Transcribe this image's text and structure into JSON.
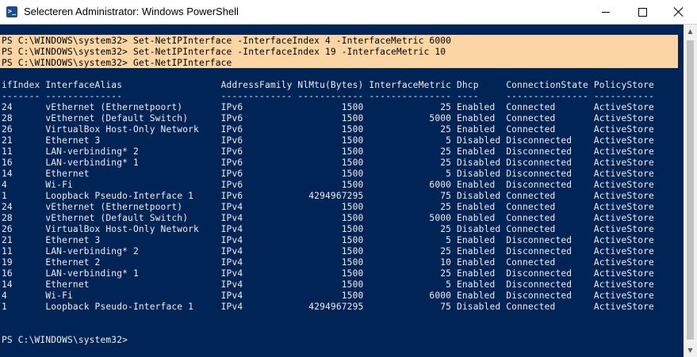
{
  "window": {
    "title": "Selecteren Administrator: Windows PowerShell",
    "icon": "powershell-icon",
    "controls": {
      "minimize": "minimize-icon",
      "maximize": "maximize-icon",
      "close": "close-icon"
    }
  },
  "colors": {
    "console_background": "#012456",
    "console_text": "#eeedf0",
    "selection_background": "#fcd5a5",
    "selection_text": "#000000"
  },
  "console": {
    "commands": [
      "PS C:\\WINDOWS\\system32> Set-NetIPInterface -InterfaceIndex 4 -InterfaceMetric 6000",
      "PS C:\\WINDOWS\\system32> Set-NetIPInterface -InterfaceIndex 19 -InterfaceMetric 10",
      "PS C:\\WINDOWS\\system32> Get-NetIPInterface"
    ],
    "header": "ifIndex InterfaceAlias                  AddressFamily NlMtu(Bytes) InterfaceMetric Dhcp     ConnectionState PolicyStore",
    "separator": "------- --------------                  ------------- ------------ --------------- ----     --------------- -----------",
    "rows": [
      "24      vEthernet (Ethernetpoort)       IPv6                  1500              25 Enabled  Connected       ActiveStore",
      "28      vEthernet (Default Switch)      IPv6                  1500            5000 Enabled  Connected       ActiveStore",
      "26      VirtualBox Host-Only Network    IPv6                  1500              25 Enabled  Connected       ActiveStore",
      "21      Ethernet 3                      IPv6                  1500               5 Disabled Disconnected    ActiveStore",
      "11      LAN-verbinding* 2               IPv6                  1500              25 Enabled  Disconnected    ActiveStore",
      "16      LAN-verbinding* 1               IPv6                  1500              25 Disabled Disconnected    ActiveStore",
      "14      Ethernet                        IPv6                  1500               5 Disabled Disconnected    ActiveStore",
      "4       Wi-Fi                           IPv6                  1500            6000 Enabled  Disconnected    ActiveStore",
      "1       Loopback Pseudo-Interface 1     IPv6            4294967295              75 Disabled Connected       ActiveStore",
      "24      vEthernet (Ethernetpoort)       IPv4                  1500              25 Enabled  Connected       ActiveStore",
      "28      vEthernet (Default Switch)      IPv4                  1500            5000 Enabled  Connected       ActiveStore",
      "26      VirtualBox Host-Only Network    IPv4                  1500              25 Disabled Connected       ActiveStore",
      "21      Ethernet 3                      IPv4                  1500               5 Enabled  Disconnected    ActiveStore",
      "11      LAN-verbinding* 2               IPv4                  1500              25 Enabled  Disconnected    ActiveStore",
      "19      Ethernet 2                      IPv4                  1500              10 Enabled  Connected       ActiveStore",
      "16      LAN-verbinding* 1               IPv4                  1500              25 Enabled  Disconnected    ActiveStore",
      "14      Ethernet                        IPv4                  1500               5 Enabled  Disconnected    ActiveStore",
      "4       Wi-Fi                           IPv4                  1500            6000 Enabled  Disconnected    ActiveStore",
      "1       Loopback Pseudo-Interface 1     IPv4            4294967295              75 Disabled Connected       ActiveStore"
    ],
    "prompt": "PS C:\\WINDOWS\\system32>"
  }
}
